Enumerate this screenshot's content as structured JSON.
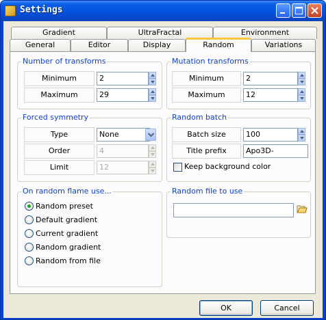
{
  "window": {
    "title": "Settings"
  },
  "tabs": {
    "row1": [
      "Gradient",
      "UltraFractal",
      "Environment"
    ],
    "row2": [
      "General",
      "Editor",
      "Display",
      "Random",
      "Variations"
    ],
    "active": "Random"
  },
  "number_of_transforms": {
    "title": "Number of transforms",
    "minimum_label": "Minimum",
    "minimum_value": "2",
    "maximum_label": "Maximum",
    "maximum_value": "29"
  },
  "mutation_transforms": {
    "title": "Mutation transforms",
    "minimum_label": "Minimum",
    "minimum_value": "2",
    "maximum_label": "Maximum",
    "maximum_value": "12"
  },
  "forced_symmetry": {
    "title": "Forced symmetry",
    "type_label": "Type",
    "type_value": "None",
    "order_label": "Order",
    "order_value": "4",
    "limit_label": "Limit",
    "limit_value": "12"
  },
  "random_batch": {
    "title": "Random batch",
    "batch_size_label": "Batch size",
    "batch_size_value": "100",
    "title_prefix_label": "Title prefix",
    "title_prefix_value": "Apo3D-",
    "keep_background_label": "Keep background color",
    "keep_background_checked": false
  },
  "on_random_flame_use": {
    "title": "On random flame use...",
    "options": [
      "Random preset",
      "Default gradient",
      "Current gradient",
      "Random gradient",
      "Random from file"
    ],
    "selected_index": 0
  },
  "random_file": {
    "title": "Random file to use",
    "path_value": ""
  },
  "buttons": {
    "ok": "OK",
    "cancel": "Cancel"
  },
  "colors": {
    "accent": "#1040c8",
    "titlebar": "#0654e0",
    "active_tab": "#ffc83c"
  }
}
